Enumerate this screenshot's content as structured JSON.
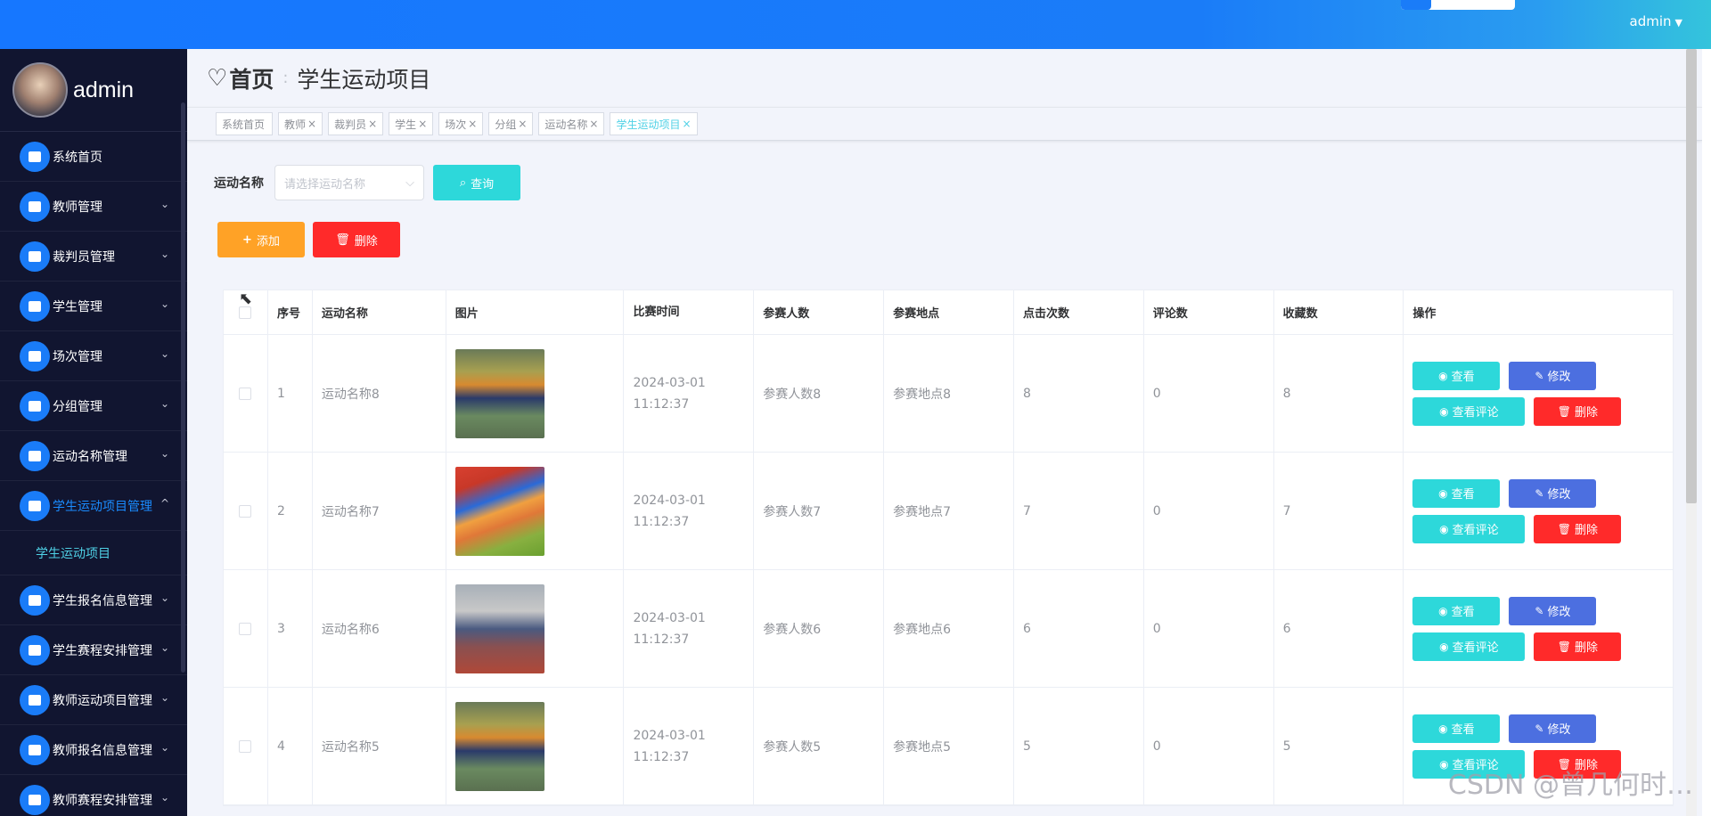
{
  "topbar": {
    "user": "admin",
    "caret": "▼"
  },
  "sidebar": {
    "username": "admin",
    "items": [
      {
        "label": "系统首页",
        "icon": "home-icon",
        "arrow": ""
      },
      {
        "label": "教师管理",
        "icon": "briefcase-icon",
        "arrow": "⌄"
      },
      {
        "label": "裁判员管理",
        "icon": "sliders-icon",
        "arrow": "⌄"
      },
      {
        "label": "学生管理",
        "icon": "graduation-icon",
        "arrow": "⌄"
      },
      {
        "label": "场次管理",
        "icon": "monitor-icon",
        "arrow": "⌄"
      },
      {
        "label": "分组管理",
        "icon": "grid-icon",
        "arrow": "⌄"
      },
      {
        "label": "运动名称管理",
        "icon": "list-icon",
        "arrow": "⌄"
      },
      {
        "label": "学生运动项目管理",
        "icon": "grid-icon",
        "arrow": "^"
      }
    ],
    "submenu": {
      "label": "学生运动项目"
    },
    "items_after": [
      {
        "label": "学生报名信息管理",
        "icon": "grid-icon",
        "arrow": "⌄"
      },
      {
        "label": "学生赛程安排管理",
        "icon": "grid-icon",
        "arrow": "⌄"
      },
      {
        "label": "教师运动项目管理",
        "icon": "clipboard-icon",
        "arrow": "⌄"
      },
      {
        "label": "教师报名信息管理",
        "icon": "book-icon",
        "arrow": "⌄"
      },
      {
        "label": "教师赛程安排管理",
        "icon": "ticket-icon",
        "arrow": "⌄"
      }
    ]
  },
  "header": {
    "home": "首页",
    "separator": ":",
    "current": "学生运动项目"
  },
  "tags": [
    {
      "label": "系统首页",
      "closable": ""
    },
    {
      "label": "教师",
      "closable": "×"
    },
    {
      "label": "裁判员",
      "closable": "×"
    },
    {
      "label": "学生",
      "closable": "×"
    },
    {
      "label": "场次",
      "closable": "×"
    },
    {
      "label": "分组",
      "closable": "×"
    },
    {
      "label": "运动名称",
      "closable": "×"
    },
    {
      "label": "学生运动项目",
      "closable": "×"
    }
  ],
  "search": {
    "label": "运动名称",
    "placeholder": "请选择运动名称",
    "query_button": "查询"
  },
  "actions": {
    "add": "添加",
    "delete": "删除"
  },
  "table": {
    "headers": [
      "序号",
      "运动名称",
      "图片",
      "比赛时间",
      "参赛人数",
      "参赛地点",
      "点击次数",
      "评论数",
      "收藏数",
      "操作"
    ],
    "rows": [
      {
        "index": "1",
        "name": "运动名称8",
        "image": "lion-dance",
        "time": "2024-03-01 11:12:37",
        "participants": "参赛人数8",
        "location": "参赛地点8",
        "clicks": "8",
        "comments": "0",
        "favorites": "8"
      },
      {
        "index": "2",
        "name": "运动名称7",
        "image": "high-jump",
        "time": "2024-03-01 11:12:37",
        "participants": "参赛人数7",
        "location": "参赛地点7",
        "clicks": "7",
        "comments": "0",
        "favorites": "7"
      },
      {
        "index": "3",
        "name": "运动名称6",
        "image": "track-run",
        "time": "2024-03-01 11:12:37",
        "participants": "参赛人数6",
        "location": "参赛地点6",
        "clicks": "6",
        "comments": "0",
        "favorites": "6"
      },
      {
        "index": "4",
        "name": "运动名称5",
        "image": "lion-dance",
        "time": "2024-03-01 11:12:37",
        "participants": "参赛人数5",
        "location": "参赛地点5",
        "clicks": "5",
        "comments": "0",
        "favorites": "5"
      }
    ],
    "ops": {
      "view": "查看",
      "edit": "修改",
      "comments": "查看评论",
      "delete": "删除"
    }
  },
  "watermark": "CSDN @曾几何时…"
}
